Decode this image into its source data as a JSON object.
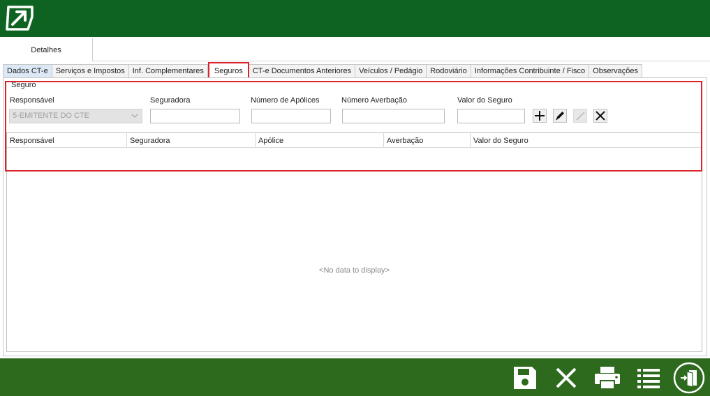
{
  "app": {
    "outer_tab": "Detalhes"
  },
  "tabs": [
    {
      "label": "Dados CT-e"
    },
    {
      "label": "Serviços e Impostos"
    },
    {
      "label": "Inf. Complementares"
    },
    {
      "label": "Seguros",
      "active": true
    },
    {
      "label": "CT-e Documentos Anteriores"
    },
    {
      "label": "Veículos / Pedágio"
    },
    {
      "label": "Rodoviário"
    },
    {
      "label": "Informações Contribuinte / Fisco"
    },
    {
      "label": "Observações"
    }
  ],
  "seguro": {
    "legend": "Seguro",
    "responsavel_label": "Responsável",
    "responsavel_value": "5-EMITENTE DO CTE",
    "seguradora_label": "Seguradora",
    "seguradora_value": "",
    "apolices_label": "Número de Apólices",
    "apolices_value": "",
    "averbacao_label": "Número Averbação",
    "averbacao_value": "",
    "valor_label": "Valor do Seguro",
    "valor_value": ""
  },
  "actions": {
    "add_icon": "plus-icon",
    "edit_icon": "pencil-icon",
    "confirm_icon": "check-icon",
    "delete_icon": "close-icon"
  },
  "grid": {
    "columns": [
      "Responsável",
      "Seguradora",
      "Apólice",
      "Averbação",
      "Valor do Seguro"
    ],
    "empty_text": "<No data to display>"
  },
  "bottom_actions": [
    "save-icon",
    "cancel-icon",
    "print-icon",
    "list-icon",
    "exit-icon"
  ],
  "colors": {
    "top_bar": "#0f6322",
    "bottom_bar": "#2d6a1d",
    "highlight": "#d8232a"
  }
}
